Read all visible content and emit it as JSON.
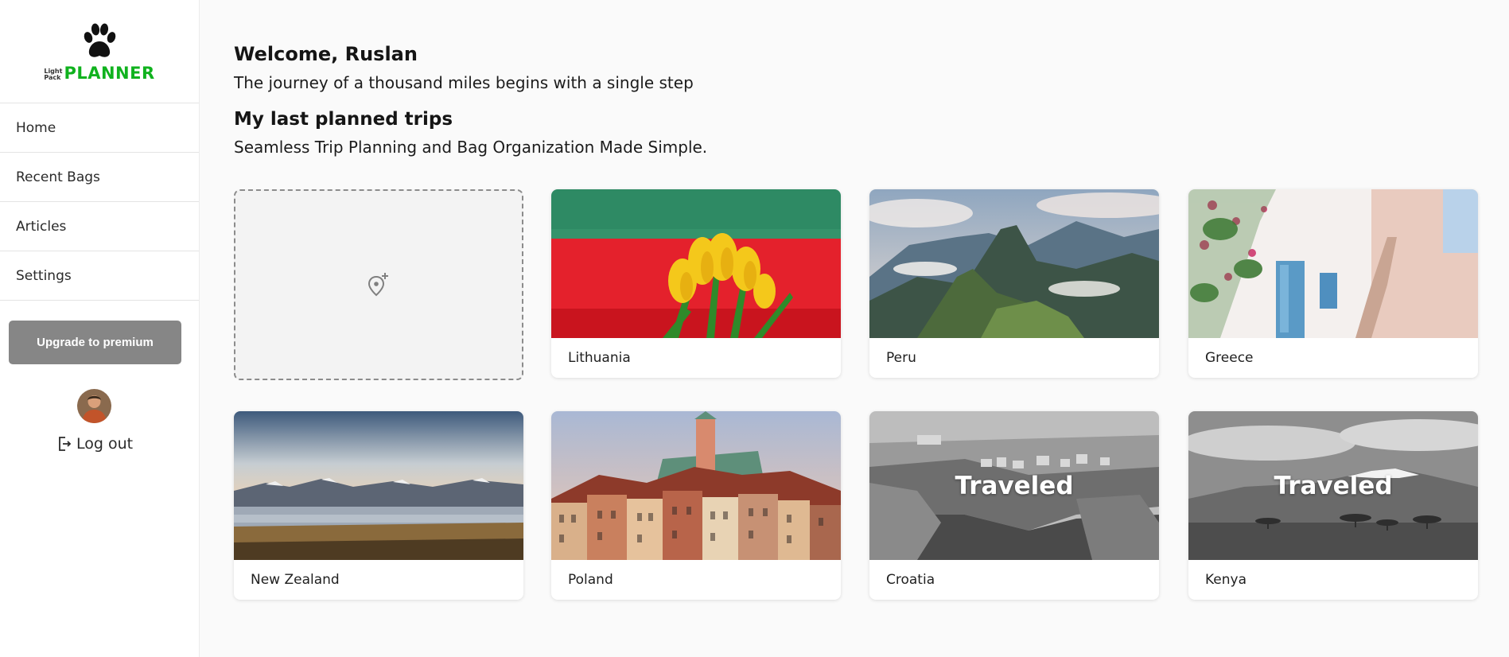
{
  "brand": {
    "logo_small_top": "Light",
    "logo_small_bottom": "Pack",
    "logo_big": "PLANNER"
  },
  "sidebar": {
    "items": [
      {
        "label": "Home",
        "icon": "home"
      },
      {
        "label": "Recent Bags",
        "icon": "bag"
      },
      {
        "label": "Articles",
        "icon": "article"
      },
      {
        "label": "Settings",
        "icon": "settings"
      }
    ],
    "upgrade_label": "Upgrade to premium",
    "logout_label": "Log out"
  },
  "main": {
    "welcome": "Welcome, Ruslan",
    "quote": "The journey of a thousand miles begins with a single step",
    "trips_title": "My last planned trips",
    "trips_subtitle": "Seamless Trip Planning and Bag Organization Made Simple."
  },
  "trips": [
    {
      "name": "Lithuania",
      "traveled": false
    },
    {
      "name": "Peru",
      "traveled": false
    },
    {
      "name": "Greece",
      "traveled": false
    },
    {
      "name": "New Zealand",
      "traveled": false
    },
    {
      "name": "Poland",
      "traveled": false
    },
    {
      "name": "Croatia",
      "traveled": true,
      "stamp": "Traveled"
    },
    {
      "name": "Kenya",
      "traveled": true,
      "stamp": "Traveled"
    }
  ],
  "colors": {
    "brand_green": "#10b21e",
    "upgrade_button": "#868686",
    "background": "#fafafa"
  }
}
